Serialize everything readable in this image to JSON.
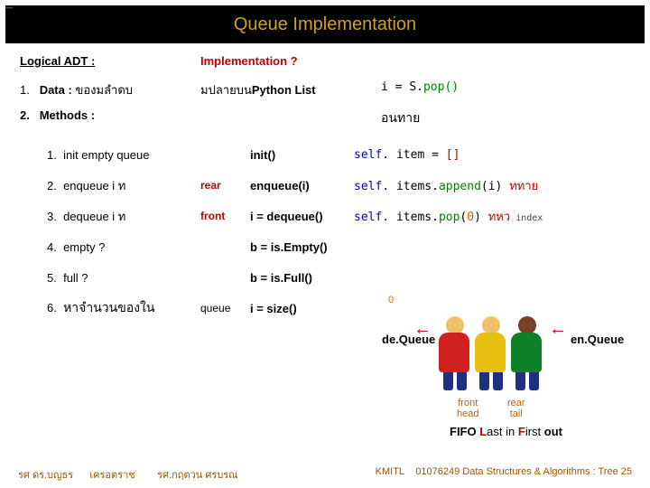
{
  "header": {
    "title": "Queue Implementation"
  },
  "row1": {
    "logical": "Logical ADT :",
    "impl": "Implementation ?"
  },
  "row2": {
    "num": "1.",
    "data_label": "Data :",
    "data_th": "ของมลำดบ",
    "mid_th": "มปลายบน",
    "pylist": "Python List",
    "code_lhs": "i =  ",
    "code_obj": "S.",
    "code_call": "pop()"
  },
  "row3": {
    "num": "2.",
    "methods": "Methods :",
    "th": "อนทาย"
  },
  "rows": [
    {
      "n": "1.",
      "label": "init empty queue",
      "mid": "",
      "call": "init()",
      "code": {
        "pre": "self. ",
        "name": "item",
        "op": " = ",
        "lit": "[]"
      }
    },
    {
      "n": "2.",
      "label": "enqueue i ท",
      "mid": "rear",
      "call": "enqueue(i)",
      "code": {
        "pre": "self. ",
        "name": "items.",
        "fn": "append",
        "args": "(i)",
        "tail_th": "  ททาย"
      }
    },
    {
      "n": "3.",
      "label": "dequeue i ท",
      "mid": "front",
      "call": "i = dequeue()",
      "code": {
        "pre": "self. ",
        "name": "items.",
        "fn": "pop",
        "args": "(",
        "argnum": "0",
        "args2": ")",
        "tail_th": "   ทหว",
        "tail_note": "       index"
      }
    },
    {
      "n": "4.",
      "label": "empty ?",
      "mid": "",
      "call": "b = is.Empty()"
    },
    {
      "n": "5.",
      "label": "full ?",
      "mid": "",
      "call": "b = is.Full()"
    },
    {
      "n": "6.",
      "label": "หาจำนวนของใน",
      "mid": "",
      "pre": "queue ",
      "call": "i = size()"
    }
  ],
  "zero": "0",
  "diagram": {
    "deq": "de.Queue",
    "enq": "en.Queue",
    "arrow": "←",
    "front": "front",
    "head": "head",
    "rear": "rear",
    "tail": "tail",
    "fifo_pre": "FIFO ",
    "fifo_l": "L",
    "fifo_mid1": "ast in ",
    "fifo_f": "F",
    "fifo_mid2": "irst ",
    "fifo_out": "out",
    "colors": {
      "p1_head": "#f0c068",
      "p1_body": "#d02020",
      "p2_head": "#f0c068",
      "p2_body": "#e8c010",
      "p3_head": "#7a4028",
      "p3_body": "#108028",
      "legs": "#203080"
    }
  },
  "footer": {
    "left1": "รศ ดร.บญธร",
    "left2": "เครอตราช",
    "left3": "รศ.กฤตวน  ศรบรณ",
    "kmitl": "KMITL",
    "right": "01076249 Data Structures & Algorithms : Tree 25"
  },
  "page": "—"
}
